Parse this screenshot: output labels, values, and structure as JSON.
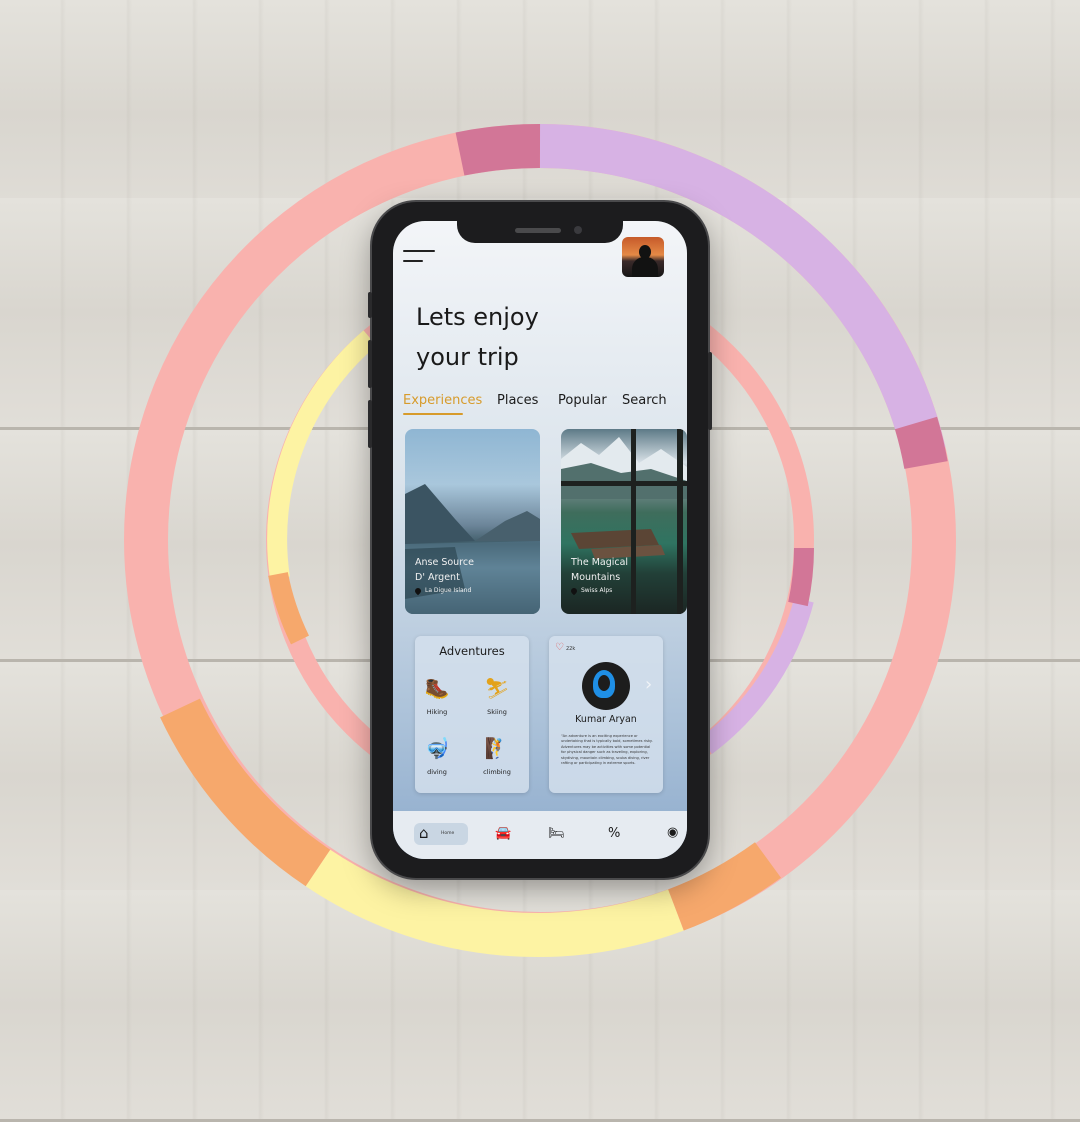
{
  "app": {
    "title": "Lets enjoy\nyour trip",
    "accent_color": "#d79b2b",
    "icon_color": "#e3a21a"
  },
  "tabs": [
    {
      "label": "Experiences",
      "active": true
    },
    {
      "label": "Places",
      "active": false
    },
    {
      "label": "Popular",
      "active": false
    },
    {
      "label": "Search",
      "active": false
    }
  ],
  "destinations": [
    {
      "name": "Anse Source\nD' Argent",
      "location": "La Digue Island",
      "icon": "location-pin-icon"
    },
    {
      "name": "The Magical\nMountains",
      "location": "Swiss Alps",
      "icon": "location-pin-icon"
    }
  ],
  "adventures": {
    "title": "Adventures",
    "activities": [
      {
        "label": "Hiking",
        "icon": "hiking-icon"
      },
      {
        "label": "Skiing",
        "icon": "skiing-icon"
      },
      {
        "label": "diving",
        "icon": "diving-icon"
      },
      {
        "label": "climbing",
        "icon": "climbing-icon"
      }
    ]
  },
  "profile": {
    "likes": "22k",
    "name": "Kumar Aryan",
    "quote": "\"An adventure is an exciting experience or undertaking that is typically bold, sometimes risky. Adventures may be activities with some potential for physical danger such as traveling, exploring, skydiving, mountain climbing, scuba diving, river rafting or participating in extreme sports."
  },
  "navbar": {
    "home_label": "Home",
    "items": [
      "home-icon",
      "car-icon",
      "bed-icon",
      "discount-icon",
      "profile-icon"
    ]
  },
  "ring_colors": {
    "pink": "#f9b2ae",
    "purple": "#d7b2e4",
    "rose": "#d27697",
    "orange": "#f6a86c",
    "yellow": "#fdf3a3"
  }
}
